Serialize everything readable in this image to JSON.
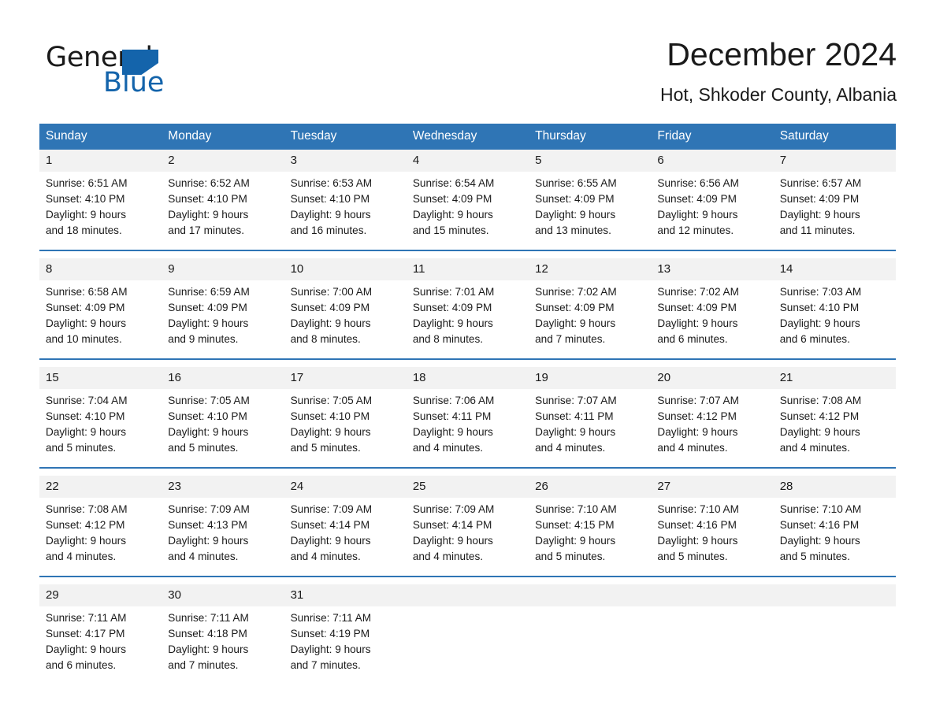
{
  "brand": {
    "name_part1": "General",
    "name_part2": "Blue",
    "triangle_color": "#1464ab",
    "logo_icon": "triangle-logo-icon"
  },
  "header": {
    "title": "December 2024",
    "subtitle": "Hot, Shkoder County, Albania"
  },
  "theme": {
    "header_blue": "#2f75b5",
    "row_band_gray": "#f2f2f2",
    "text_dark": "#1a1a1a",
    "background": "#ffffff"
  },
  "weekday_headers": [
    "Sunday",
    "Monday",
    "Tuesday",
    "Wednesday",
    "Thursday",
    "Friday",
    "Saturday"
  ],
  "weeks": [
    {
      "days": [
        {
          "num": "1",
          "sunrise": "Sunrise: 6:51 AM",
          "sunset": "Sunset: 4:10 PM",
          "daylight1": "Daylight: 9 hours",
          "daylight2": "and 18 minutes."
        },
        {
          "num": "2",
          "sunrise": "Sunrise: 6:52 AM",
          "sunset": "Sunset: 4:10 PM",
          "daylight1": "Daylight: 9 hours",
          "daylight2": "and 17 minutes."
        },
        {
          "num": "3",
          "sunrise": "Sunrise: 6:53 AM",
          "sunset": "Sunset: 4:10 PM",
          "daylight1": "Daylight: 9 hours",
          "daylight2": "and 16 minutes."
        },
        {
          "num": "4",
          "sunrise": "Sunrise: 6:54 AM",
          "sunset": "Sunset: 4:09 PM",
          "daylight1": "Daylight: 9 hours",
          "daylight2": "and 15 minutes."
        },
        {
          "num": "5",
          "sunrise": "Sunrise: 6:55 AM",
          "sunset": "Sunset: 4:09 PM",
          "daylight1": "Daylight: 9 hours",
          "daylight2": "and 13 minutes."
        },
        {
          "num": "6",
          "sunrise": "Sunrise: 6:56 AM",
          "sunset": "Sunset: 4:09 PM",
          "daylight1": "Daylight: 9 hours",
          "daylight2": "and 12 minutes."
        },
        {
          "num": "7",
          "sunrise": "Sunrise: 6:57 AM",
          "sunset": "Sunset: 4:09 PM",
          "daylight1": "Daylight: 9 hours",
          "daylight2": "and 11 minutes."
        }
      ]
    },
    {
      "days": [
        {
          "num": "8",
          "sunrise": "Sunrise: 6:58 AM",
          "sunset": "Sunset: 4:09 PM",
          "daylight1": "Daylight: 9 hours",
          "daylight2": "and 10 minutes."
        },
        {
          "num": "9",
          "sunrise": "Sunrise: 6:59 AM",
          "sunset": "Sunset: 4:09 PM",
          "daylight1": "Daylight: 9 hours",
          "daylight2": "and 9 minutes."
        },
        {
          "num": "10",
          "sunrise": "Sunrise: 7:00 AM",
          "sunset": "Sunset: 4:09 PM",
          "daylight1": "Daylight: 9 hours",
          "daylight2": "and 8 minutes."
        },
        {
          "num": "11",
          "sunrise": "Sunrise: 7:01 AM",
          "sunset": "Sunset: 4:09 PM",
          "daylight1": "Daylight: 9 hours",
          "daylight2": "and 8 minutes."
        },
        {
          "num": "12",
          "sunrise": "Sunrise: 7:02 AM",
          "sunset": "Sunset: 4:09 PM",
          "daylight1": "Daylight: 9 hours",
          "daylight2": "and 7 minutes."
        },
        {
          "num": "13",
          "sunrise": "Sunrise: 7:02 AM",
          "sunset": "Sunset: 4:09 PM",
          "daylight1": "Daylight: 9 hours",
          "daylight2": "and 6 minutes."
        },
        {
          "num": "14",
          "sunrise": "Sunrise: 7:03 AM",
          "sunset": "Sunset: 4:10 PM",
          "daylight1": "Daylight: 9 hours",
          "daylight2": "and 6 minutes."
        }
      ]
    },
    {
      "days": [
        {
          "num": "15",
          "sunrise": "Sunrise: 7:04 AM",
          "sunset": "Sunset: 4:10 PM",
          "daylight1": "Daylight: 9 hours",
          "daylight2": "and 5 minutes."
        },
        {
          "num": "16",
          "sunrise": "Sunrise: 7:05 AM",
          "sunset": "Sunset: 4:10 PM",
          "daylight1": "Daylight: 9 hours",
          "daylight2": "and 5 minutes."
        },
        {
          "num": "17",
          "sunrise": "Sunrise: 7:05 AM",
          "sunset": "Sunset: 4:10 PM",
          "daylight1": "Daylight: 9 hours",
          "daylight2": "and 5 minutes."
        },
        {
          "num": "18",
          "sunrise": "Sunrise: 7:06 AM",
          "sunset": "Sunset: 4:11 PM",
          "daylight1": "Daylight: 9 hours",
          "daylight2": "and 4 minutes."
        },
        {
          "num": "19",
          "sunrise": "Sunrise: 7:07 AM",
          "sunset": "Sunset: 4:11 PM",
          "daylight1": "Daylight: 9 hours",
          "daylight2": "and 4 minutes."
        },
        {
          "num": "20",
          "sunrise": "Sunrise: 7:07 AM",
          "sunset": "Sunset: 4:12 PM",
          "daylight1": "Daylight: 9 hours",
          "daylight2": "and 4 minutes."
        },
        {
          "num": "21",
          "sunrise": "Sunrise: 7:08 AM",
          "sunset": "Sunset: 4:12 PM",
          "daylight1": "Daylight: 9 hours",
          "daylight2": "and 4 minutes."
        }
      ]
    },
    {
      "days": [
        {
          "num": "22",
          "sunrise": "Sunrise: 7:08 AM",
          "sunset": "Sunset: 4:12 PM",
          "daylight1": "Daylight: 9 hours",
          "daylight2": "and 4 minutes."
        },
        {
          "num": "23",
          "sunrise": "Sunrise: 7:09 AM",
          "sunset": "Sunset: 4:13 PM",
          "daylight1": "Daylight: 9 hours",
          "daylight2": "and 4 minutes."
        },
        {
          "num": "24",
          "sunrise": "Sunrise: 7:09 AM",
          "sunset": "Sunset: 4:14 PM",
          "daylight1": "Daylight: 9 hours",
          "daylight2": "and 4 minutes."
        },
        {
          "num": "25",
          "sunrise": "Sunrise: 7:09 AM",
          "sunset": "Sunset: 4:14 PM",
          "daylight1": "Daylight: 9 hours",
          "daylight2": "and 4 minutes."
        },
        {
          "num": "26",
          "sunrise": "Sunrise: 7:10 AM",
          "sunset": "Sunset: 4:15 PM",
          "daylight1": "Daylight: 9 hours",
          "daylight2": "and 5 minutes."
        },
        {
          "num": "27",
          "sunrise": "Sunrise: 7:10 AM",
          "sunset": "Sunset: 4:16 PM",
          "daylight1": "Daylight: 9 hours",
          "daylight2": "and 5 minutes."
        },
        {
          "num": "28",
          "sunrise": "Sunrise: 7:10 AM",
          "sunset": "Sunset: 4:16 PM",
          "daylight1": "Daylight: 9 hours",
          "daylight2": "and 5 minutes."
        }
      ]
    },
    {
      "days": [
        {
          "num": "29",
          "sunrise": "Sunrise: 7:11 AM",
          "sunset": "Sunset: 4:17 PM",
          "daylight1": "Daylight: 9 hours",
          "daylight2": "and 6 minutes."
        },
        {
          "num": "30",
          "sunrise": "Sunrise: 7:11 AM",
          "sunset": "Sunset: 4:18 PM",
          "daylight1": "Daylight: 9 hours",
          "daylight2": "and 7 minutes."
        },
        {
          "num": "31",
          "sunrise": "Sunrise: 7:11 AM",
          "sunset": "Sunset: 4:19 PM",
          "daylight1": "Daylight: 9 hours",
          "daylight2": "and 7 minutes."
        },
        {
          "num": "",
          "sunrise": "",
          "sunset": "",
          "daylight1": "",
          "daylight2": ""
        },
        {
          "num": "",
          "sunrise": "",
          "sunset": "",
          "daylight1": "",
          "daylight2": ""
        },
        {
          "num": "",
          "sunrise": "",
          "sunset": "",
          "daylight1": "",
          "daylight2": ""
        },
        {
          "num": "",
          "sunrise": "",
          "sunset": "",
          "daylight1": "",
          "daylight2": ""
        }
      ]
    }
  ]
}
